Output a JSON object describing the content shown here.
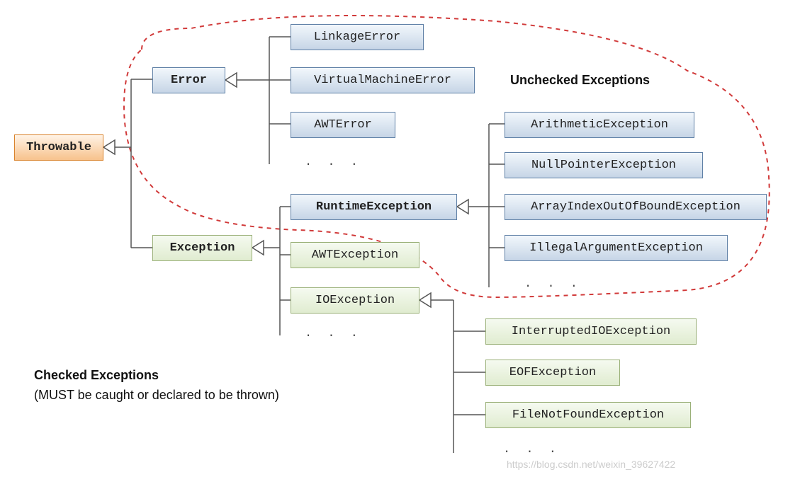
{
  "root": "Throwable",
  "error": {
    "name": "Error",
    "children": [
      "LinkageError",
      "VirtualMachineError",
      "AWTError"
    ]
  },
  "exception": {
    "name": "Exception",
    "runtime": {
      "name": "RuntimeException",
      "children": [
        "ArithmeticException",
        "NullPointerException",
        "ArrayIndexOutOfBoundException",
        "IllegalArgumentException"
      ]
    },
    "checked": [
      "AWTException",
      "IOException"
    ],
    "io_children": [
      "InterruptedIOException",
      "EOFException",
      "FileNotFoundException"
    ]
  },
  "labels": {
    "unchecked": "Unchecked Exceptions",
    "checked_title": "Checked Exceptions",
    "checked_sub": "(MUST be caught or declared to be thrown)"
  },
  "ellipsis": ". . .",
  "watermark": "https://blog.csdn.net/weixin_39627422"
}
